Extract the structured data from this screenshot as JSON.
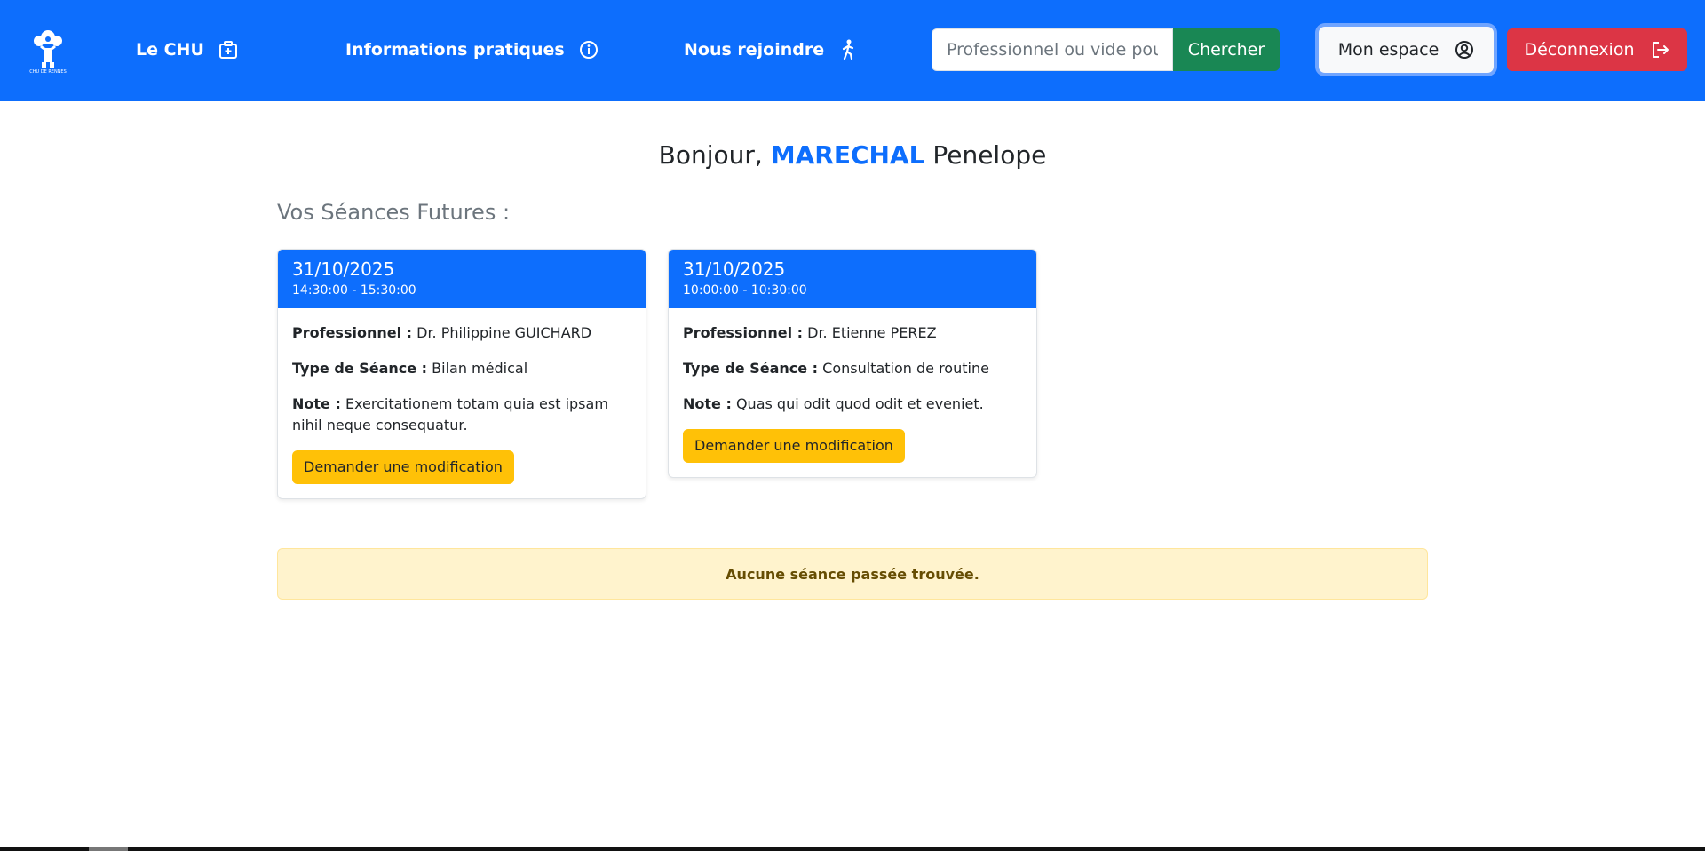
{
  "navbar": {
    "logo_text": "CHU DE RENNES",
    "links": [
      {
        "label": "Le CHU",
        "icon": "hospital-icon"
      },
      {
        "label": "Informations pratiques",
        "icon": "info-circle-icon"
      },
      {
        "label": "Nous rejoindre",
        "icon": "person-walking-icon"
      }
    ],
    "search": {
      "placeholder": "Professionnel ou vide pour tous",
      "button_label": "Chercher"
    },
    "account_label": "Mon espace",
    "logout_label": "Déconnexion"
  },
  "greeting": {
    "prefix": "Bonjour,",
    "last_name": "MARECHAL",
    "first_name": "Penelope"
  },
  "upcoming": {
    "title": "Vos Séances Futures :",
    "sessions": [
      {
        "date": "31/10/2025",
        "time": "14:30:00 - 15:30:00",
        "professional_label": "Professionnel :",
        "professional": "Dr. Philippine GUICHARD",
        "type_label": "Type de Séance :",
        "type": "Bilan médical",
        "note_label": "Note :",
        "note": "Exercitationem totam quia est ipsam nihil neque consequatur.",
        "button_label": "Demander une modification"
      },
      {
        "date": "31/10/2025",
        "time": "10:00:00 - 10:30:00",
        "professional_label": "Professionnel :",
        "professional": "Dr. Etienne PEREZ",
        "type_label": "Type de Séance :",
        "type": "Consultation de routine",
        "note_label": "Note :",
        "note": "Quas qui odit quod odit et eveniet.",
        "button_label": "Demander une modification"
      }
    ]
  },
  "past": {
    "empty_message": "Aucune séance passée trouvée."
  },
  "colors": {
    "primary": "#0d6efd",
    "success": "#198754",
    "danger": "#dc3545",
    "warning": "#ffc107",
    "alert_bg": "#fff3cd"
  }
}
